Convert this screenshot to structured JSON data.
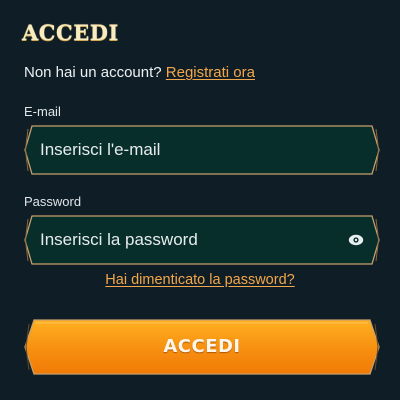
{
  "header": {
    "title": "ACCEDI"
  },
  "signup": {
    "prompt": "Non hai un account?",
    "link": "Registrati ora"
  },
  "email": {
    "label": "E-mail",
    "placeholder": "Inserisci l'e-mail",
    "value": ""
  },
  "password": {
    "label": "Password",
    "placeholder": "Inserisci la password",
    "value": "",
    "toggle_icon": "eye-icon"
  },
  "forgot_link": "Hai dimenticato la password?",
  "submit": {
    "label": "ACCEDI"
  },
  "colors": {
    "background": "#0f1d26",
    "field_fill": "#072e2b",
    "field_border": "#c7a06a",
    "link": "#f3a74a",
    "button_top": "#ffb021",
    "button_bottom": "#f07a06",
    "title": "#f7ecc2"
  }
}
